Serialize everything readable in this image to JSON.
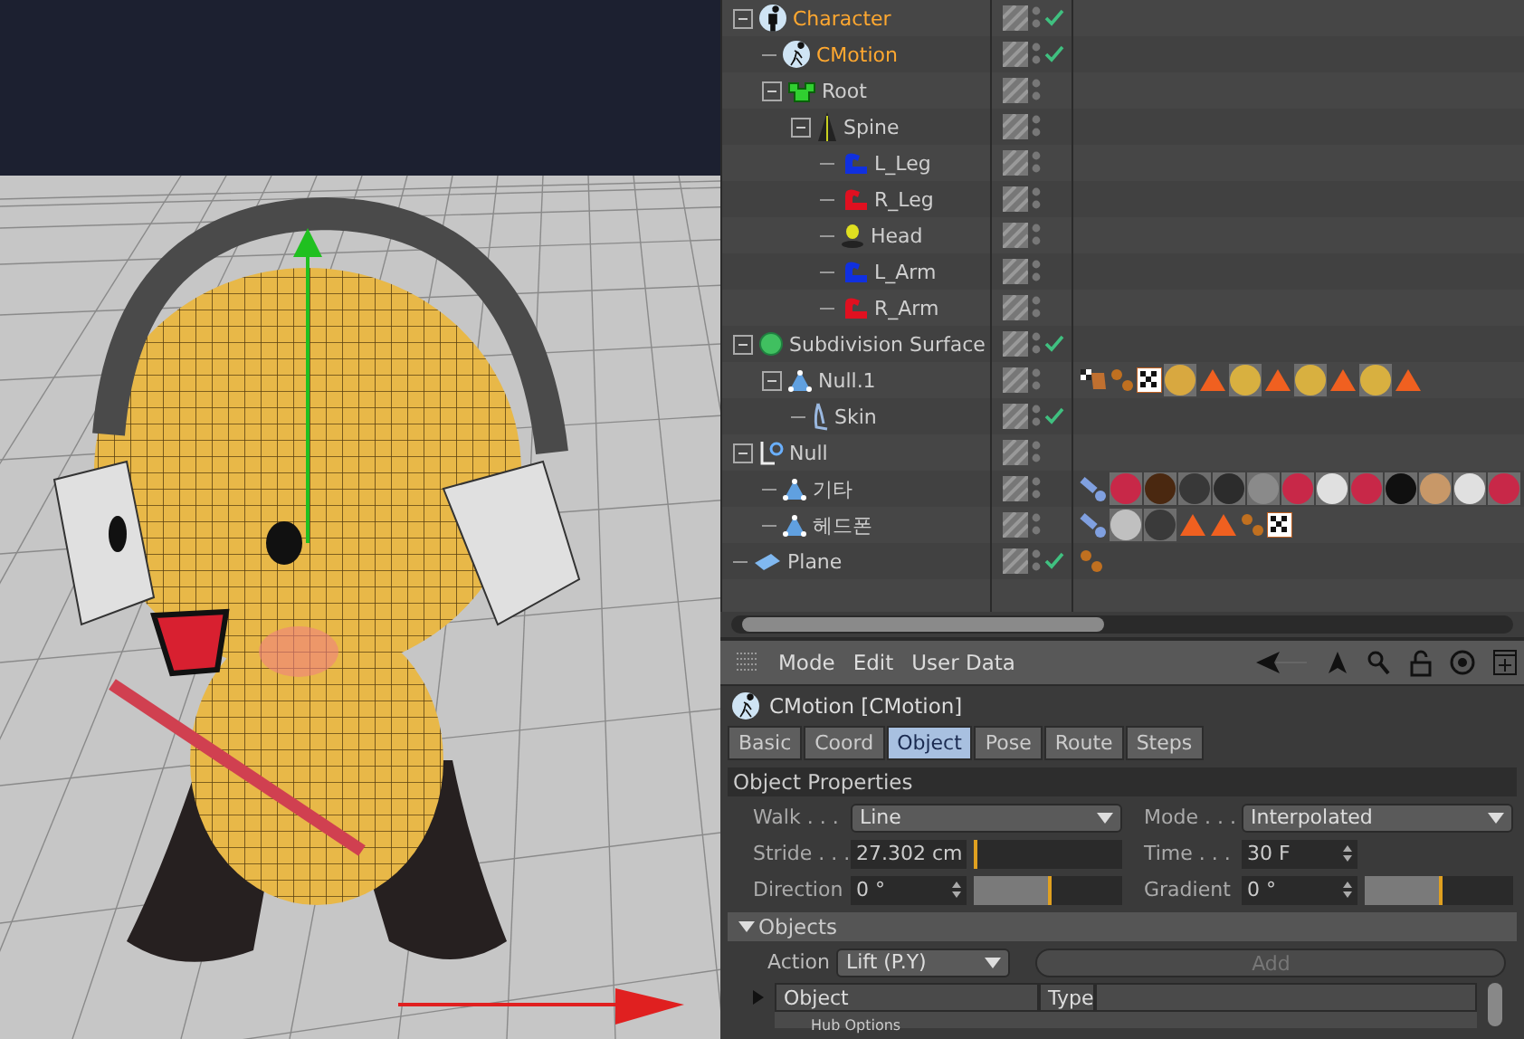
{
  "objects": [
    {
      "name": "Character",
      "kind": "character",
      "selected": true,
      "checked": true,
      "expanded": true,
      "children": [
        {
          "name": "CMotion",
          "kind": "cmotion",
          "selected": true,
          "checked": true
        },
        {
          "name": "Root",
          "kind": "root",
          "selected": false,
          "checked": false,
          "expanded": true,
          "children": [
            {
              "name": "Spine",
              "kind": "spine",
              "selected": false,
              "checked": false,
              "expanded": true,
              "children": [
                {
                  "name": "L_Leg",
                  "kind": "limb-blue",
                  "selected": false,
                  "checked": false
                },
                {
                  "name": "R_Leg",
                  "kind": "limb-red",
                  "selected": false,
                  "checked": false
                },
                {
                  "name": "Head",
                  "kind": "head",
                  "selected": false,
                  "checked": false
                },
                {
                  "name": "L_Arm",
                  "kind": "limb-blue",
                  "selected": false,
                  "checked": false
                },
                {
                  "name": "R_Arm",
                  "kind": "limb-red",
                  "selected": false,
                  "checked": false
                }
              ]
            }
          ]
        }
      ]
    },
    {
      "name": "Subdivision Surface",
      "kind": "subdivision",
      "selected": false,
      "checked": true,
      "expanded": true,
      "children": [
        {
          "name": "Null.1",
          "kind": "polygon",
          "selected": false,
          "checked": false,
          "expanded": true,
          "tags": [
            {
              "kind": "weight"
            },
            {
              "kind": "dots"
            },
            {
              "kind": "checker"
            },
            {
              "kind": "sphere",
              "color": "#d8a840"
            },
            {
              "kind": "triangle"
            },
            {
              "kind": "sphere",
              "color": "#d8b040"
            },
            {
              "kind": "triangle"
            },
            {
              "kind": "sphere",
              "color": "#d8b040"
            },
            {
              "kind": "triangle"
            },
            {
              "kind": "sphere",
              "color": "#d8b040"
            },
            {
              "kind": "triangle"
            }
          ],
          "children": [
            {
              "name": "Skin",
              "kind": "skin",
              "selected": false,
              "checked": true
            }
          ]
        }
      ]
    },
    {
      "name": "Null",
      "kind": "null",
      "selected": false,
      "checked": false,
      "expanded": true,
      "children": [
        {
          "name": "기타",
          "kind": "polygon",
          "selected": false,
          "checked": false,
          "tags": [
            {
              "kind": "joint"
            },
            {
              "kind": "sphere",
              "color": "#c82848"
            },
            {
              "kind": "sphere",
              "color": "#4a2810"
            },
            {
              "kind": "sphere",
              "color": "#383838"
            },
            {
              "kind": "sphere",
              "color": "#2c2c2c"
            },
            {
              "kind": "sphere",
              "color": "#8a8a8a"
            },
            {
              "kind": "sphere",
              "color": "#c82848"
            },
            {
              "kind": "sphere",
              "color": "#e0e0e0"
            },
            {
              "kind": "sphere",
              "color": "#c82848"
            },
            {
              "kind": "sphere",
              "color": "#101010"
            },
            {
              "kind": "sphere",
              "color": "#c89868"
            },
            {
              "kind": "sphere",
              "color": "#e0e0e0"
            },
            {
              "kind": "sphere",
              "color": "#c82848"
            }
          ]
        },
        {
          "name": "헤드폰",
          "kind": "polygon",
          "selected": false,
          "checked": false,
          "tags": [
            {
              "kind": "joint"
            },
            {
              "kind": "sphere",
              "color": "#c0c0c0"
            },
            {
              "kind": "sphere",
              "color": "#3a3a3a"
            },
            {
              "kind": "triangle"
            },
            {
              "kind": "triangle"
            },
            {
              "kind": "dots"
            },
            {
              "kind": "checker"
            }
          ]
        }
      ]
    },
    {
      "name": "Plane",
      "kind": "plane",
      "selected": false,
      "checked": true,
      "tags": [
        {
          "kind": "dots"
        }
      ]
    }
  ],
  "attributes": {
    "menu": [
      "Mode",
      "Edit",
      "User Data"
    ],
    "title": "CMotion [CMotion]",
    "tabs": [
      {
        "label": "Basic",
        "selected": false
      },
      {
        "label": "Coord",
        "selected": false
      },
      {
        "label": "Object",
        "selected": true
      },
      {
        "label": "Pose",
        "selected": false
      },
      {
        "label": "Route",
        "selected": false
      },
      {
        "label": "Steps",
        "selected": false
      }
    ],
    "section": "Object Properties",
    "fields": [
      {
        "kind": "dropdown",
        "label": "Walk . . .",
        "value": "Line"
      },
      {
        "kind": "dropdown",
        "label": "Mode . . .",
        "value": "Interpolated"
      },
      {
        "kind": "slider",
        "label": "Stride . . .",
        "value": "27.302 cm",
        "level": 0.02
      },
      {
        "kind": "number",
        "label": "Time . . .",
        "value": "30 F"
      },
      {
        "kind": "slider",
        "label": "Direction",
        "value": "0 °",
        "level": 0.52
      },
      {
        "kind": "slider",
        "label": "Gradient",
        "value": "0 °",
        "level": 0.52
      }
    ],
    "objects_section": {
      "title": "Objects",
      "expanded": true,
      "action_label": "Action",
      "action_value": "Lift (P.Y)",
      "add_button": {
        "label": "Add",
        "disabled": true
      },
      "columns": [
        "Object",
        "Type"
      ],
      "rows": [
        "Hub Options"
      ]
    }
  }
}
